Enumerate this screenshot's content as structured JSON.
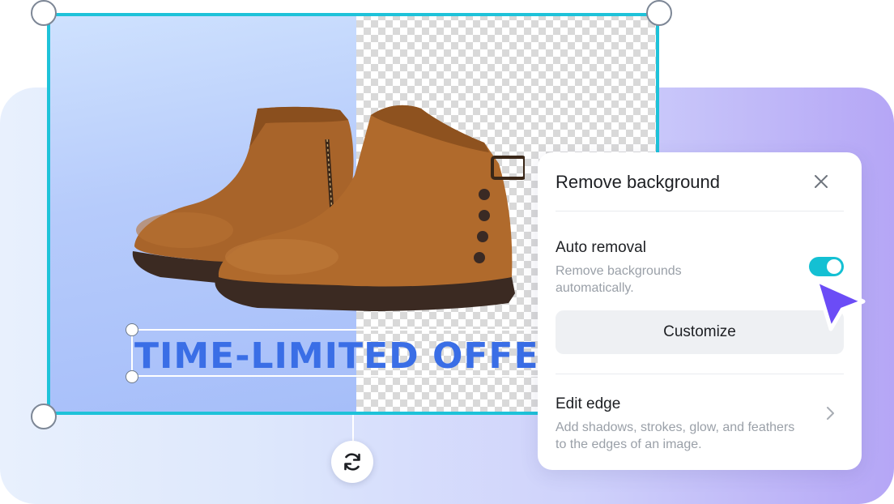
{
  "canvas": {
    "offer_text": "TIME-LIMITED OFFER",
    "image_subject": "brown-suede-ankle-boots"
  },
  "panel": {
    "title": "Remove background",
    "auto_removal": {
      "title": "Auto removal",
      "description": "Remove backgrounds automatically.",
      "enabled": true
    },
    "customize_label": "Customize",
    "edit_edge": {
      "title": "Edit edge",
      "description": "Add shadows, strokes, glow, and feathers to the edges of an image."
    }
  },
  "colors": {
    "accent": "#1ec2d9",
    "toggle_on": "#14c0d3",
    "cursor": "#6b4cf6",
    "offer_text": "#3a6ee6"
  },
  "icons": {
    "close": "close-icon",
    "rotate": "rotate-icon",
    "chevron": "chevron-right-icon",
    "cursor": "pointer-cursor-icon"
  }
}
